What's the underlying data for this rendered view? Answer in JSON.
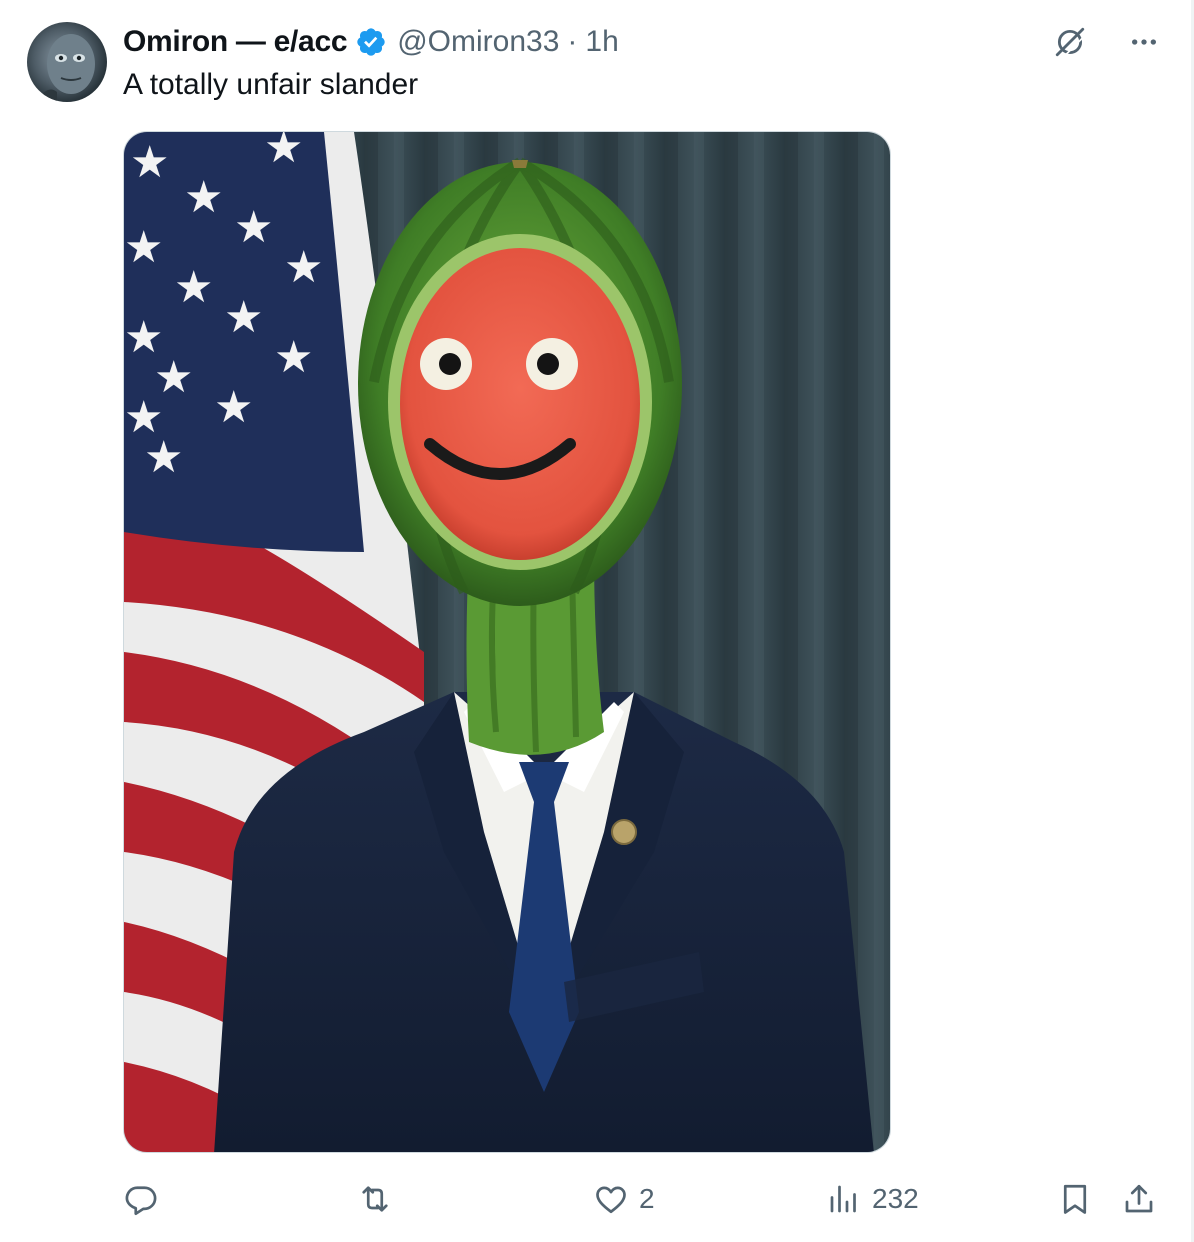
{
  "tweet": {
    "author_name": "Omiron — e/acc",
    "verified": true,
    "handle": "@Omiron33",
    "separator": "·",
    "time": "1h",
    "text": "A totally unfair slander",
    "media": {
      "alt_subject": "watermelon-headed man in navy suit in front of US flag"
    }
  },
  "actions": {
    "reply": {
      "icon": "reply-icon",
      "count": ""
    },
    "repost": {
      "icon": "repost-icon",
      "count": ""
    },
    "like": {
      "icon": "heart-icon",
      "count": "2"
    },
    "views": {
      "icon": "views-icon",
      "count": "232"
    },
    "bookmark": {
      "icon": "bookmark-icon"
    },
    "share": {
      "icon": "share-icon"
    }
  },
  "header_icons": [
    "grok-icon",
    "more-icon"
  ],
  "colors": {
    "text": "#0f1419",
    "secondary": "#536471",
    "verified": "#1d9bf0",
    "border": "#cfd9de"
  }
}
